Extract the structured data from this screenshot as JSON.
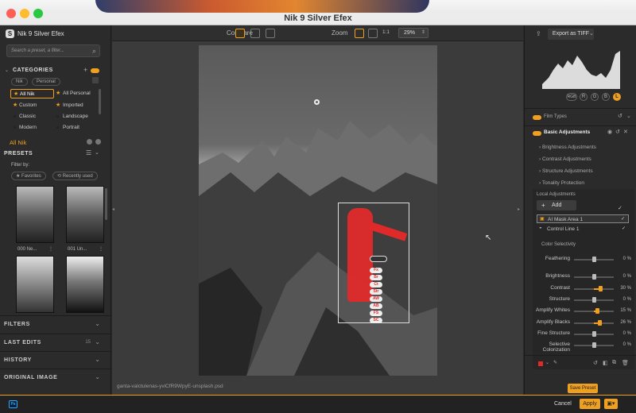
{
  "window": {
    "title": "Nik 9 Silver Efex"
  },
  "colors": {
    "accent": "#f0a020",
    "red_mask": "#e02a2a",
    "traffic_red": "#ff5f57",
    "traffic_yellow": "#febc2e",
    "traffic_green": "#28c840"
  },
  "left": {
    "app_name": "Nik 9 Silver Efex",
    "search_placeholder": "Search a preset, a filter...",
    "categories_title": "CATEGORIES",
    "filter_chips": [
      "Nik",
      "Personal"
    ],
    "categories": [
      {
        "label": "All Nik",
        "icon": "star-icon",
        "active": true
      },
      {
        "label": "All Personal",
        "icon": "star-icon"
      },
      {
        "label": "Custom",
        "icon": "star-icon"
      },
      {
        "label": "Imported",
        "icon": "star-icon"
      },
      {
        "label": "Classic",
        "icon": "dot-icon"
      },
      {
        "label": "Landscape",
        "icon": "dot-icon"
      },
      {
        "label": "Modern",
        "icon": "dot-icon"
      },
      {
        "label": "Portrait",
        "icon": "dot-icon"
      }
    ],
    "current_category": "All Nik",
    "presets_title": "PRESETS",
    "filter_by": "Filter by:",
    "favorites": "Favorites",
    "recently_used": "Recently used",
    "thumbs": [
      "000 Ne...",
      "001 Un...",
      "",
      ""
    ],
    "sections": [
      "FILTERS",
      "LAST EDITS",
      "HISTORY",
      "ORIGINAL IMAGE"
    ],
    "last_edits_count": "15"
  },
  "center": {
    "compare_label": "Compare",
    "zoom_label": "Zoom",
    "zoom_value": "29%",
    "zoom_ratio": "1:1",
    "filename": "ganta-valctulenas-yviCfR9WpyE-unsplash.psd",
    "mask_tags": [
      "Fx",
      "Br",
      "Ct",
      "Str",
      "AW",
      "AB",
      "FS",
      "SC"
    ]
  },
  "right": {
    "export_label": "Export as TIFF",
    "histogram_buttons": [
      "RGB",
      "R",
      "G",
      "B",
      "L"
    ],
    "film_types": "Film Types",
    "basic_adjustments": "Basic Adjustments",
    "adjust_links": [
      "Brightness Adjustments",
      "Contrast Adjustments",
      "Structure Adjustments",
      "Tonality Protection"
    ],
    "local_adjustments": "Local Adjustments",
    "add_label": "Add",
    "masks": [
      {
        "label": "AI Mask Area 1"
      },
      {
        "label": "Control Line 1"
      }
    ],
    "color_selectivity": "Color Selectivity",
    "sliders": [
      {
        "label": "Feathering",
        "value": "0 %",
        "level": 0
      },
      {
        "label": "Brightness",
        "value": "0 %",
        "level": 0
      },
      {
        "label": "Contrast",
        "value": "30 %",
        "level": 30
      },
      {
        "label": "Structure",
        "value": "0 %",
        "level": 0
      },
      {
        "label": "Amplify Whites",
        "value": "15 %",
        "level": 15
      },
      {
        "label": "Amplify Blacks",
        "value": "26 %",
        "level": 26
      },
      {
        "label": "Fine Structure",
        "value": "0 %",
        "level": 0
      },
      {
        "label": "Selective Colorization",
        "value": "0 %",
        "level": 0
      }
    ]
  },
  "bottom": {
    "ps_badge": "Ps",
    "save_preset": "Save Preset",
    "cancel": "Cancel",
    "apply": "Apply"
  }
}
